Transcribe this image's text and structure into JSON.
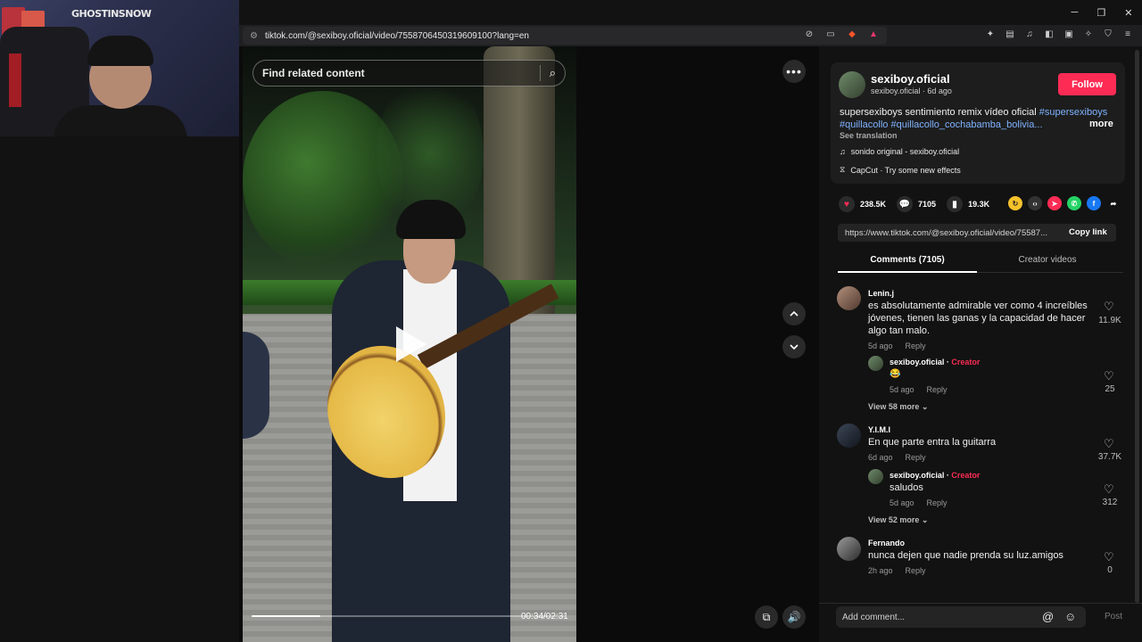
{
  "webcam": {
    "logo_text": "GHOSTINSNOW"
  },
  "window": {
    "minimize": "─",
    "maximize": "❐",
    "close": "✕"
  },
  "browser": {
    "url": "tiktok.com/@sexiboy.oficial/video/7558706450319609100?lang=en",
    "tune_icon": "tune-icon"
  },
  "video": {
    "search_placeholder": "Find related content",
    "timecode": "00:34/02:31",
    "progress_fraction": 0.22
  },
  "author": {
    "name": "sexiboy.oficial",
    "sub": "sexiboy.oficial · 6d ago",
    "follow_label": "Follow",
    "description_text": "supersexiboys sentimiento remix vídeo oficial ",
    "hashtag1": "#supersexiboys",
    "hashtag2": "#quillacollo",
    "hashtag3": "#quillacollo_cochabamba_bolivia...",
    "more_label": "more",
    "see_translation": "See translation",
    "sound": "sonido original - sexiboy.oficial",
    "capcut": "CapCut · Try some new effects"
  },
  "actions": {
    "likes": "238.5K",
    "comments": "7105",
    "saves": "19.3K"
  },
  "share": {
    "link": "https://www.tiktok.com/@sexiboy.oficial/video/75587...",
    "copy_label": "Copy link"
  },
  "tabs": {
    "comments": "Comments (7105)",
    "creator": "Creator videos"
  },
  "comments": [
    {
      "name": "Lenin.j",
      "text": "es absolutamente admirable ver como 4 increíbles jóvenes, tienen las ganas y la capacidad de hacer algo tan malo.",
      "time": "5d ago",
      "reply": "Reply",
      "likes": "11.9K",
      "sub": {
        "name": "sexiboy.oficial",
        "badge": "Creator",
        "sep": " · ",
        "text": "😂",
        "time": "5d ago",
        "reply": "Reply",
        "likes": "25"
      },
      "view_more": "View 58 more"
    },
    {
      "name": "Y.I.M.I",
      "text": "En que parte entra la guitarra",
      "time": "6d ago",
      "reply": "Reply",
      "likes": "37.7K",
      "sub": {
        "name": "sexiboy.oficial",
        "badge": "Creator",
        "sep": " · ",
        "text": "saludos",
        "time": "5d ago",
        "reply": "Reply",
        "likes": "312"
      },
      "view_more": "View 52 more"
    },
    {
      "name": "Fernando",
      "text": "nunca dejen que nadie prenda su luz.amigos",
      "time": "2h ago",
      "reply": "Reply",
      "likes": "0"
    }
  ],
  "comment_bar": {
    "placeholder": "Add comment...",
    "post_label": "Post"
  },
  "colors": {
    "accent": "#fe2c55",
    "hashtag": "#7fb3ff"
  }
}
